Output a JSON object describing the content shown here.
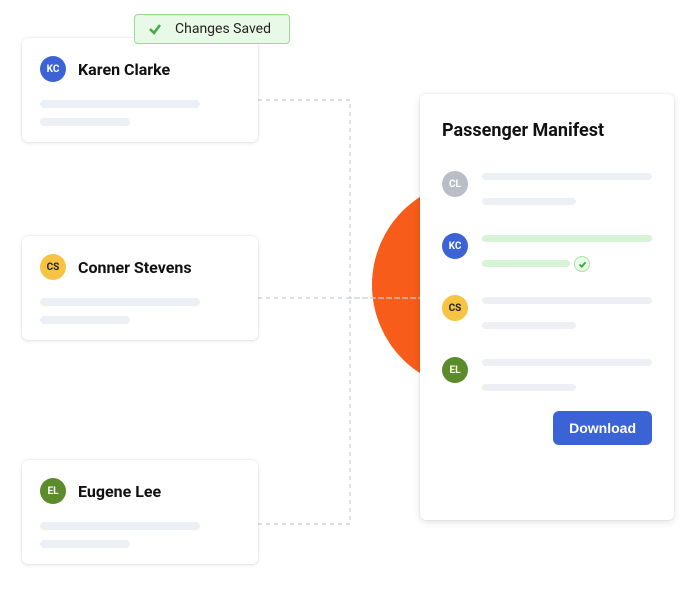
{
  "toast": {
    "message": "Changes Saved"
  },
  "passengers": [
    {
      "initials": "KC",
      "name": "Karen Clarke",
      "color": "kc"
    },
    {
      "initials": "CS",
      "name": "Conner Stevens",
      "color": "cs"
    },
    {
      "initials": "EL",
      "name": "Eugene Lee",
      "color": "el"
    }
  ],
  "manifest": {
    "title": "Passenger Manifest",
    "rows": [
      {
        "initials": "CL",
        "color": "cl",
        "highlight": false
      },
      {
        "initials": "KC",
        "color": "kc",
        "highlight": true
      },
      {
        "initials": "CS",
        "color": "cs",
        "highlight": false
      },
      {
        "initials": "EL",
        "color": "el",
        "highlight": false
      }
    ],
    "download_label": "Download"
  }
}
